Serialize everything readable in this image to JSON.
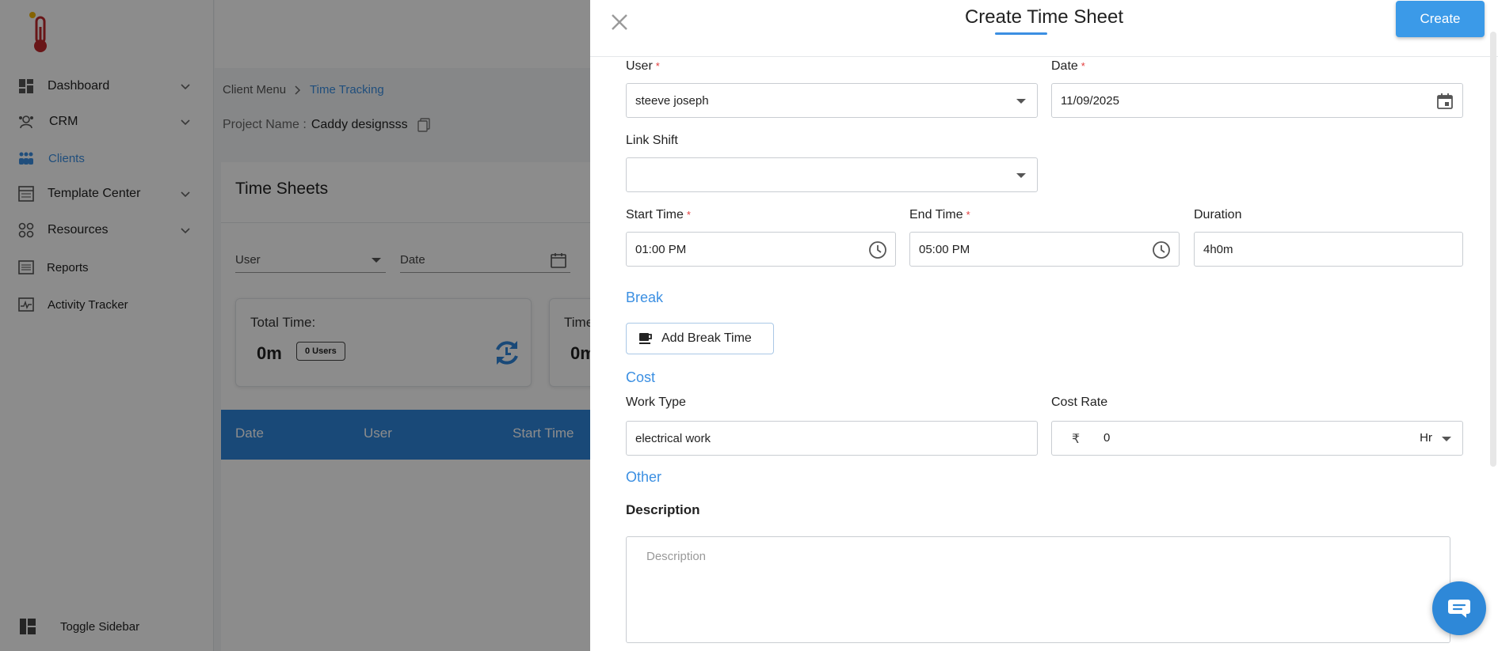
{
  "sidebar": {
    "items": [
      {
        "label": "Dashboard",
        "icon": "dashboard-icon"
      },
      {
        "label": "CRM",
        "icon": "crm-icon"
      },
      {
        "label": "Clients",
        "icon": "clients-icon"
      },
      {
        "label": "Template Center",
        "icon": "template-icon"
      },
      {
        "label": "Resources",
        "icon": "resources-icon"
      },
      {
        "label": "Reports",
        "icon": "reports-icon"
      },
      {
        "label": "Activity Tracker",
        "icon": "activity-icon"
      }
    ],
    "active": "Clients",
    "toggle_label": "Toggle Sidebar"
  },
  "breadcrumb": {
    "root": "Client Menu",
    "current": "Time Tracking"
  },
  "project": {
    "label": "Project Name :",
    "value": "Caddy designsss"
  },
  "timesheets": {
    "title": "Time Sheets",
    "filter_user": "User",
    "filter_date": "Date",
    "stat_cards": [
      {
        "label": "Total Time:",
        "value": "0m",
        "badge": "0 Users"
      },
      {
        "label": "Time",
        "value": "0m"
      }
    ],
    "columns": [
      "Date",
      "User",
      "Start Time"
    ]
  },
  "drawer": {
    "title": "Create Time Sheet",
    "create_label": "Create",
    "user": {
      "label": "User",
      "value": "steeve joseph"
    },
    "date": {
      "label": "Date",
      "value": "11/09/2025"
    },
    "link_shift": {
      "label": "Link Shift",
      "value": ""
    },
    "start_time": {
      "label": "Start Time",
      "value": "01:00 PM"
    },
    "end_time": {
      "label": "End Time",
      "value": "05:00 PM"
    },
    "duration": {
      "label": "Duration",
      "value": "4h0m"
    },
    "break_section": "Break",
    "add_break_label": "Add Break Time",
    "cost_section": "Cost",
    "work_type": {
      "label": "Work Type",
      "value": "electrical work"
    },
    "cost_rate": {
      "label": "Cost Rate",
      "currency": "₹",
      "value": "0",
      "unit": "Hr"
    },
    "other_section": "Other",
    "description": {
      "label": "Description",
      "placeholder": "Description"
    },
    "required_mark": "*"
  },
  "colors": {
    "accent": "#3b8fe2",
    "button": "#3b9ae8",
    "table_header": "#2f86db",
    "required": "#e23b3b"
  }
}
